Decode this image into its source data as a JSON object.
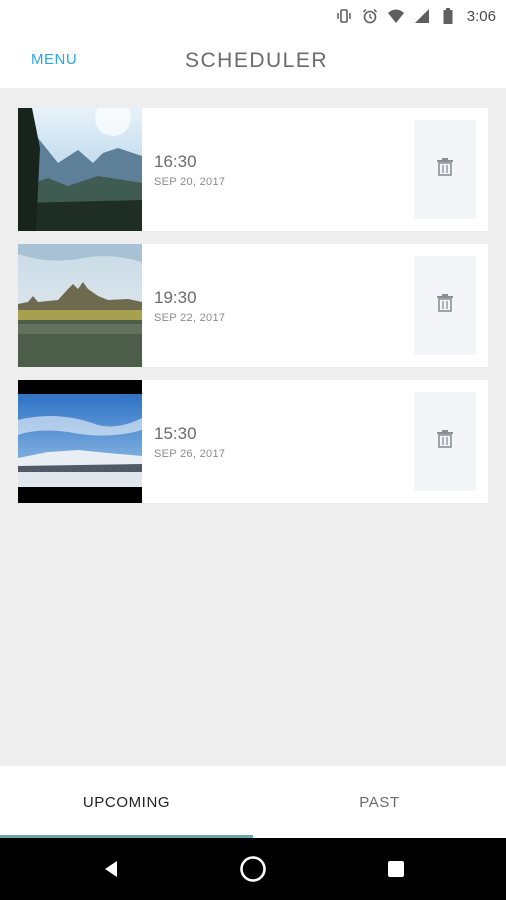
{
  "status_bar": {
    "time": "3:06",
    "icons": [
      "vibrate-icon",
      "alarm-icon",
      "wifi-icon",
      "signal-icon",
      "battery-icon"
    ]
  },
  "header": {
    "menu_label": "MENU",
    "title": "SCHEDULER"
  },
  "schedules": [
    {
      "time": "16:30",
      "date": "SEP 20, 2017",
      "thumbnail": "yosemite-valley"
    },
    {
      "time": "19:30",
      "date": "SEP 22, 2017",
      "thumbnail": "temple-reflection"
    },
    {
      "time": "15:30",
      "date": "SEP 26, 2017",
      "thumbnail": "snowy-landscape"
    }
  ],
  "tabs": [
    {
      "label": "UPCOMING",
      "active": true
    },
    {
      "label": "PAST",
      "active": false
    }
  ],
  "colors": {
    "accent": "#29a8e0",
    "tab_indicator": "#6aa6ae",
    "background": "#eeeeee"
  }
}
